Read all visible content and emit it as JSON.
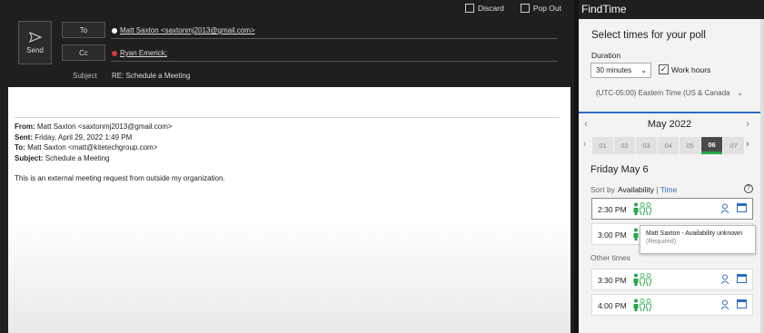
{
  "toolbar": {
    "discard_label": "Discard",
    "popout_label": "Pop Out"
  },
  "compose": {
    "send_label": "Send",
    "to_label": "To",
    "cc_label": "Cc",
    "to_recipient": "Matt Saxton <saxtonmj2013@gmail.com>",
    "cc_recipient": "Ryan Emerick;",
    "subject_label": "Subject",
    "subject_value": "RE: Schedule a Meeting",
    "body": {
      "from_label": "From:",
      "from_value": " Matt Saxton <saxtonmj2013@gmail.com>",
      "sent_label": "Sent:",
      "sent_value": " Friday, April 29, 2022 1:49 PM",
      "to_label": "To:",
      "to_value": " Matt Saxton <matt@kitetechgroup.com>",
      "subject_label": "Subject:",
      "subject_value": " Schedule a Meeting",
      "message": "This is an external meeting request from outside my organization."
    }
  },
  "findtime": {
    "title": "FindTime",
    "heading": "Select times for your poll",
    "duration_label": "Duration",
    "duration_value": "30 minutes",
    "work_hours_label": "Work hours",
    "work_hours_checked": true,
    "timezone": "(UTC-05:00) Eastern Time (US & Canada",
    "month": "May 2022",
    "days": [
      "01",
      "02",
      "03",
      "04",
      "05",
      "06",
      "07"
    ],
    "selected_day": "06",
    "date_heading": "Friday May 6",
    "sort_label": "Sort by",
    "sort_availability": "Availability",
    "sort_separator": " | ",
    "sort_time": "Time",
    "help_label": "?",
    "slots": [
      {
        "time": "2:30 PM"
      },
      {
        "time": "3:00 PM"
      }
    ],
    "other_times_label": "Other times",
    "other_slots": [
      {
        "time": "3:30 PM"
      },
      {
        "time": "4:00 PM"
      }
    ],
    "tooltip": {
      "name": "Matt Saxton",
      "status": " - Availability unknown",
      "role": "(Required)"
    },
    "colors": {
      "accent": "#2b6dc2",
      "available": "#26a64a",
      "unknown": "#d23c3c"
    }
  }
}
